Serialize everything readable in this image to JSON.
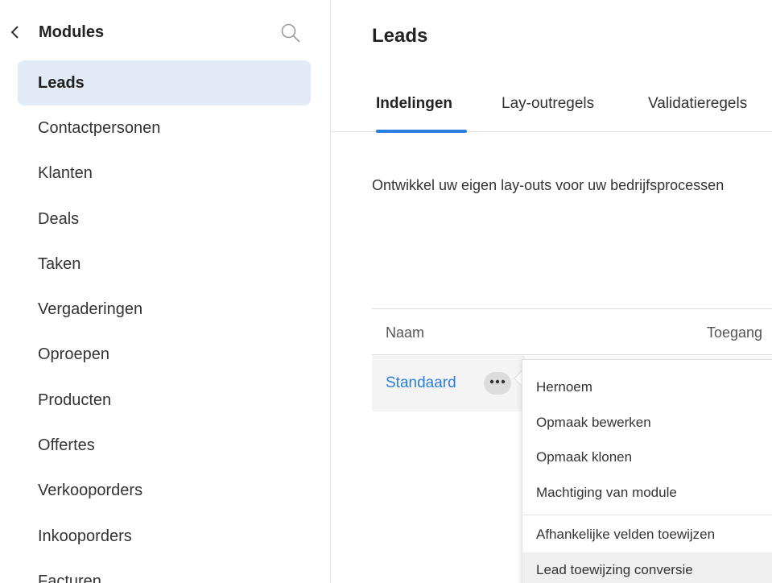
{
  "sidebar": {
    "title": "Modules",
    "back_icon": "chevron-left-icon",
    "search_icon": "search-icon",
    "items": [
      {
        "label": "Leads",
        "active": true
      },
      {
        "label": "Contactpersonen"
      },
      {
        "label": "Klanten"
      },
      {
        "label": "Deals"
      },
      {
        "label": "Taken"
      },
      {
        "label": "Vergaderingen"
      },
      {
        "label": "Oproepen"
      },
      {
        "label": "Producten"
      },
      {
        "label": "Offertes"
      },
      {
        "label": "Verkooporders"
      },
      {
        "label": "Inkooporders"
      },
      {
        "label": "Facturen"
      }
    ]
  },
  "main": {
    "title": "Leads",
    "tabs": [
      {
        "label": "Indelingen",
        "active": true
      },
      {
        "label": "Lay-outregels"
      },
      {
        "label": "Validatieregels"
      }
    ],
    "description": "Ontwikkel uw eigen lay-outs voor uw bedrijfsprocessen",
    "table": {
      "columns": [
        "Naam",
        "Toegang"
      ],
      "rows": [
        {
          "name": "Standaard"
        }
      ]
    },
    "more_icon": "more-horizontal-icon"
  },
  "menu": {
    "items": [
      "Hernoem",
      "Opmaak bewerken",
      "Opmaak klonen",
      "Machtiging van module",
      "Afhankelijke velden toewijzen",
      "Lead toewijzing conversie"
    ]
  },
  "colors": {
    "accent": "#2a7de1",
    "active_bg": "#e2eaf5",
    "hover_bg": "#efefef"
  }
}
